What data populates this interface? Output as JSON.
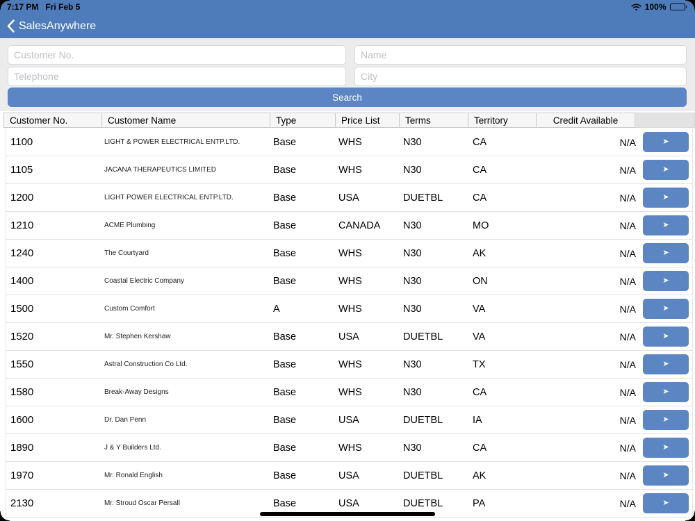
{
  "status_bar": {
    "time": "7:17 PM",
    "date": "Fri Feb 5",
    "battery_percent": "100%"
  },
  "nav": {
    "title": "SalesAnywhere"
  },
  "search": {
    "customer_no_placeholder": "Customer No.",
    "name_placeholder": "Name",
    "telephone_placeholder": "Telephone",
    "city_placeholder": "City",
    "button_label": "Search"
  },
  "table": {
    "columns": [
      "Customer No.",
      "Customer Name",
      "Type",
      "Price List",
      "Terms",
      "Territory",
      "Credit Available"
    ],
    "rows": [
      {
        "no": "1100",
        "name": "LIGHT & POWER ELECTRICAL ENTP.LTD.",
        "type": "Base",
        "price_list": "WHS",
        "terms": "N30",
        "territory": "CA",
        "credit": "N/A"
      },
      {
        "no": "1105",
        "name": "JACANA THERAPEUTICS LIMITED",
        "type": "Base",
        "price_list": "WHS",
        "terms": "N30",
        "territory": "CA",
        "credit": "N/A"
      },
      {
        "no": "1200",
        "name": "LIGHT  POWER ELECTRICAL ENTP.LTD.",
        "type": "Base",
        "price_list": "USA",
        "terms": "DUETBL",
        "territory": "CA",
        "credit": "N/A"
      },
      {
        "no": "1210",
        "name": "ACME Plumbing",
        "type": "Base",
        "price_list": "CANADA",
        "terms": "N30",
        "territory": "MO",
        "credit": "N/A"
      },
      {
        "no": "1240",
        "name": "The Courtyard",
        "type": "Base",
        "price_list": "WHS",
        "terms": "N30",
        "territory": "AK",
        "credit": "N/A"
      },
      {
        "no": "1400",
        "name": "Coastal Electric Company",
        "type": "Base",
        "price_list": "WHS",
        "terms": "N30",
        "territory": "ON",
        "credit": "N/A"
      },
      {
        "no": "1500",
        "name": "Custom Comfort",
        "type": "A",
        "price_list": "WHS",
        "terms": "N30",
        "territory": "VA",
        "credit": "N/A"
      },
      {
        "no": "1520",
        "name": "Mr. Stephen Kershaw",
        "type": "Base",
        "price_list": "USA",
        "terms": "DUETBL",
        "territory": "VA",
        "credit": "N/A"
      },
      {
        "no": "1550",
        "name": "Astral Construction Co Ltd.",
        "type": "Base",
        "price_list": "WHS",
        "terms": "N30",
        "territory": "TX",
        "credit": "N/A"
      },
      {
        "no": "1580",
        "name": "Break-Away Designs",
        "type": "Base",
        "price_list": "WHS",
        "terms": "N30",
        "territory": "CA",
        "credit": "N/A"
      },
      {
        "no": "1600",
        "name": "Dr. Dan Penn",
        "type": "Base",
        "price_list": "USA",
        "terms": "DUETBL",
        "territory": "IA",
        "credit": "N/A"
      },
      {
        "no": "1890",
        "name": "J & Y Builders Ltd.",
        "type": "Base",
        "price_list": "WHS",
        "terms": "N30",
        "territory": "CA",
        "credit": "N/A"
      },
      {
        "no": "1970",
        "name": "Mr. Ronald English",
        "type": "Base",
        "price_list": "USA",
        "terms": "DUETBL",
        "territory": "AK",
        "credit": "N/A"
      },
      {
        "no": "2130",
        "name": "Mr. Stroud Oscar Persall",
        "type": "Base",
        "price_list": "USA",
        "terms": "DUETBL",
        "territory": "PA",
        "credit": "N/A"
      }
    ],
    "row_action_icon": "➤"
  },
  "colors": {
    "top_bar_blue": "#4e7cba",
    "button_blue": "#5b86c3",
    "panel_gray": "#ececec"
  }
}
